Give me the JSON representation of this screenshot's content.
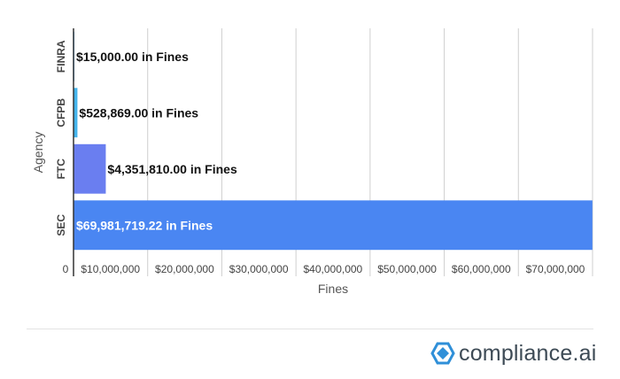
{
  "chart_data": {
    "type": "bar",
    "orientation": "horizontal",
    "categories": [
      "FINRA",
      "CFPB",
      "FTC",
      "SEC"
    ],
    "values": [
      15000.0,
      528869.0,
      4351810.0,
      69981719.22
    ],
    "data_labels": [
      "$15,000.00 in Fines",
      "$528,869.00 in Fines",
      "$4,351,810.00 in Fines",
      "$69,981,719.22 in Fines"
    ],
    "bar_colors": [
      "#4fa6e6",
      "#44b4ec",
      "#6a7ef0",
      "#4a86f2"
    ],
    "xlabel": "Fines",
    "ylabel": "Agency",
    "xlim": [
      0,
      70000000
    ],
    "x_ticks": [
      0,
      10000000,
      20000000,
      30000000,
      40000000,
      50000000,
      60000000,
      70000000
    ],
    "x_tick_labels": [
      "0",
      "$10,000,000",
      "$20,000,000",
      "$30,000,000",
      "$40,000,000",
      "$50,000,000",
      "$60,000,000",
      "$70,000,000"
    ],
    "grid": true
  },
  "brand": {
    "name": "compliance.ai",
    "logo_icon": "hexagon-diamond-icon",
    "logo_color": "#2f8fd8"
  }
}
